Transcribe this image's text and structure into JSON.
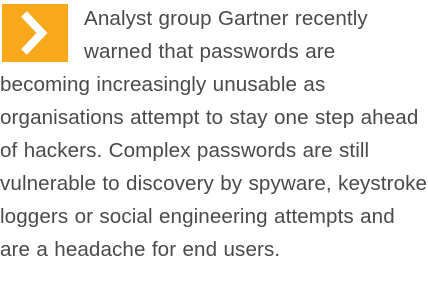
{
  "article": {
    "icon": "chevron-right-icon",
    "accent_color": "#f5a623",
    "text_color": "#4a4a4a",
    "paragraph": "Analyst group Gartner recently warned that passwords are becoming increasingly unusable as organisations attempt to stay one step ahead of hackers. Complex passwords are still vulnerable to discovery by spyware, keystroke loggers or social engineering attempts and are a headache for end users."
  }
}
